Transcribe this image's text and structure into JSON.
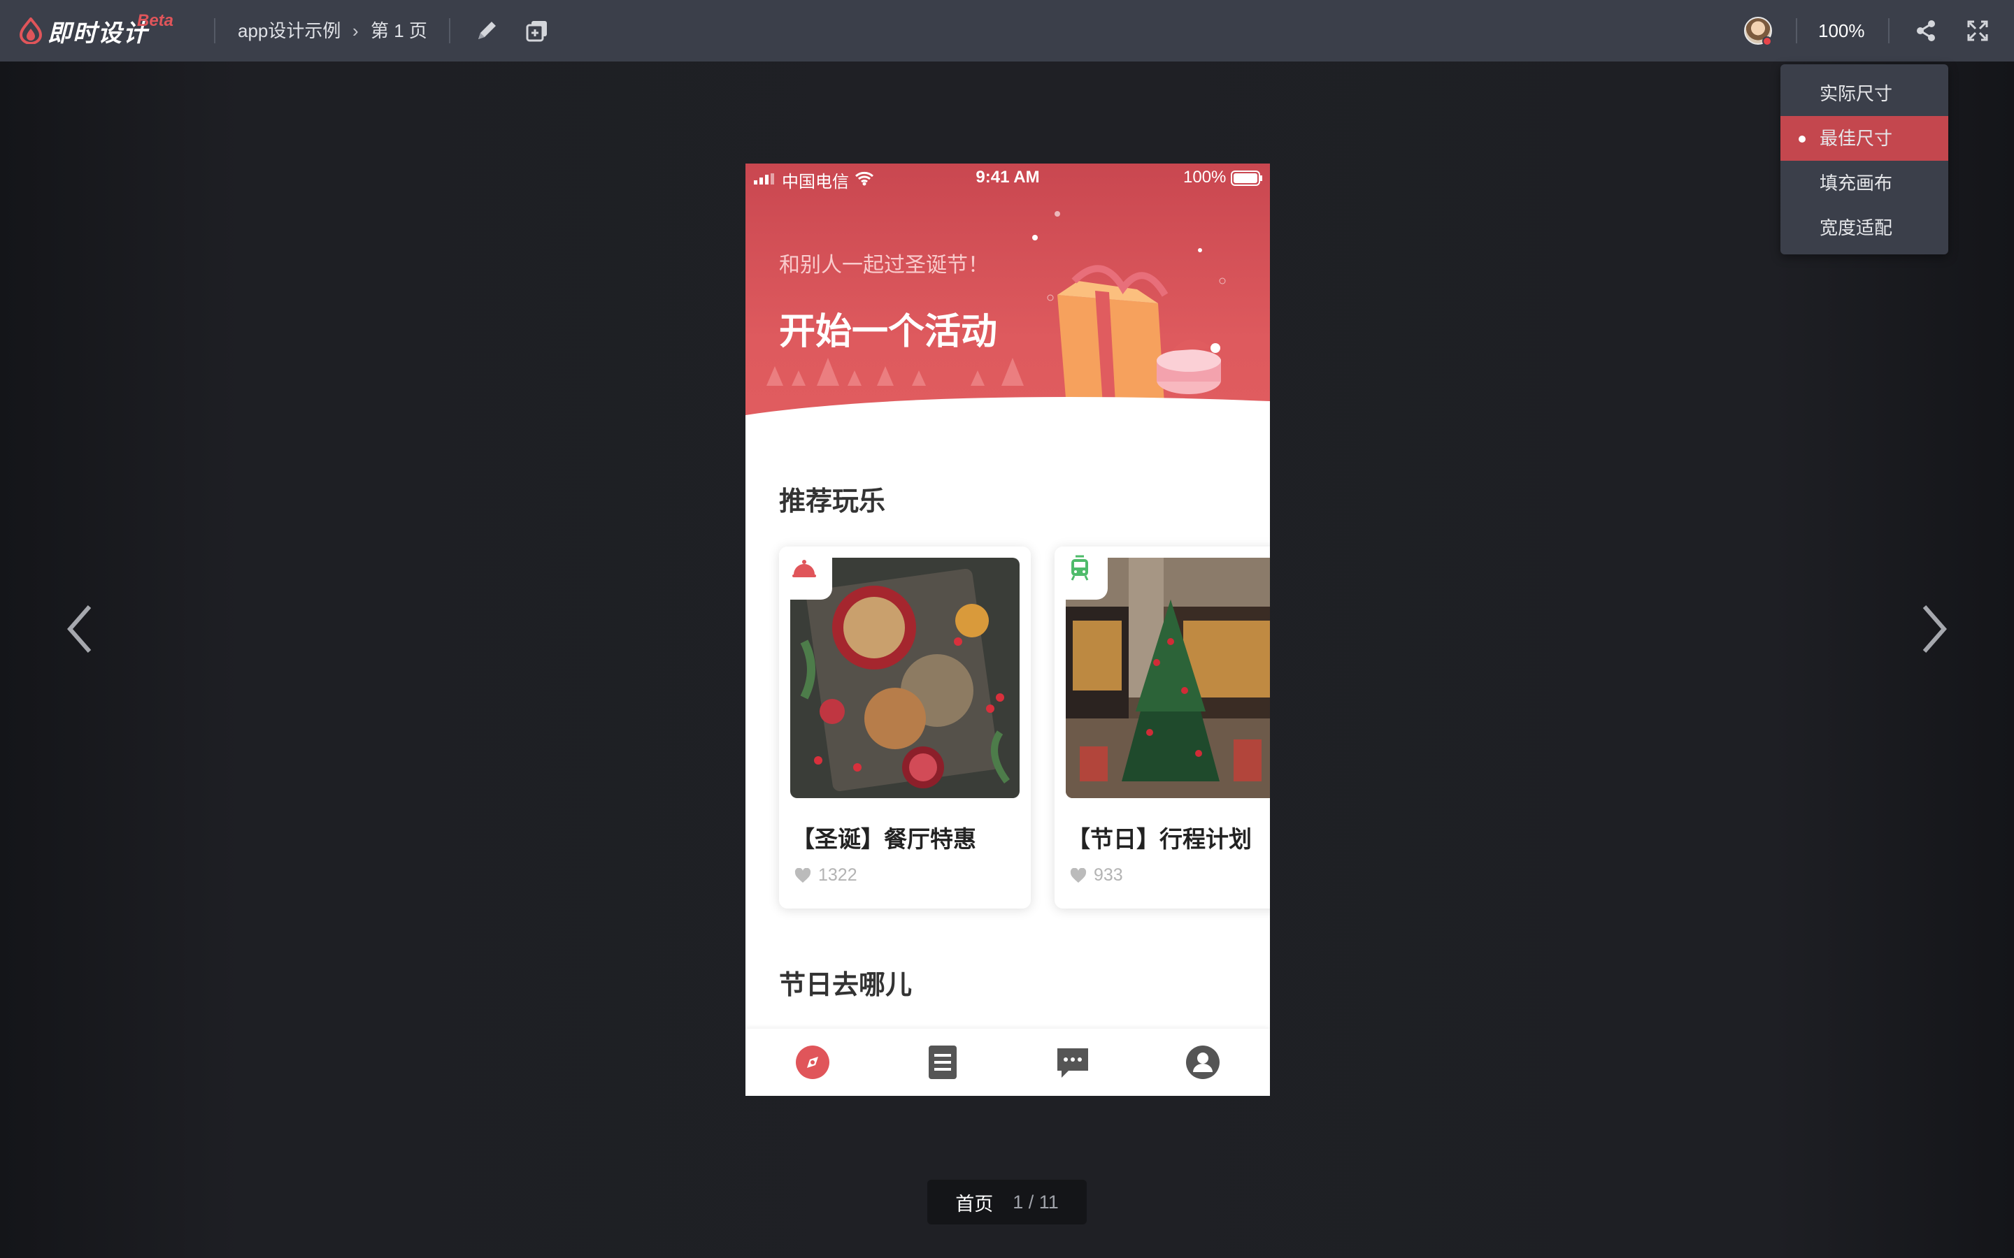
{
  "topbar": {
    "logo_text": "即时设计",
    "beta": "Beta",
    "breadcrumb": [
      "app设计示例",
      "第 1 页"
    ],
    "zoom": "100%"
  },
  "zoom_menu": {
    "items": [
      {
        "label": "实际尺寸",
        "selected": false
      },
      {
        "label": "最佳尺寸",
        "selected": true
      },
      {
        "label": "填充画布",
        "selected": false
      },
      {
        "label": "宽度适配",
        "selected": false
      }
    ]
  },
  "pager": {
    "label": "首页",
    "page": "1 / 11"
  },
  "phone": {
    "status": {
      "carrier": "中国电信",
      "time": "9:41 AM",
      "battery": "100%"
    },
    "hero": {
      "subtitle": "和别人一起过圣诞节！",
      "title": "开始一个活动"
    },
    "section1": "推荐玩乐",
    "cards": [
      {
        "title": "【圣诞】餐厅特惠",
        "likes": "1322",
        "icon": "food-cloche-icon"
      },
      {
        "title": "【节日】行程计划",
        "likes": "933",
        "icon": "tram-icon"
      }
    ],
    "section2": "节日去哪儿",
    "tabs": [
      "compass-icon",
      "list-icon",
      "message-icon",
      "profile-icon"
    ]
  },
  "colors": {
    "accent": "#e0555a",
    "topbar": "#3b3f4a",
    "menu_active": "#c4474e"
  }
}
